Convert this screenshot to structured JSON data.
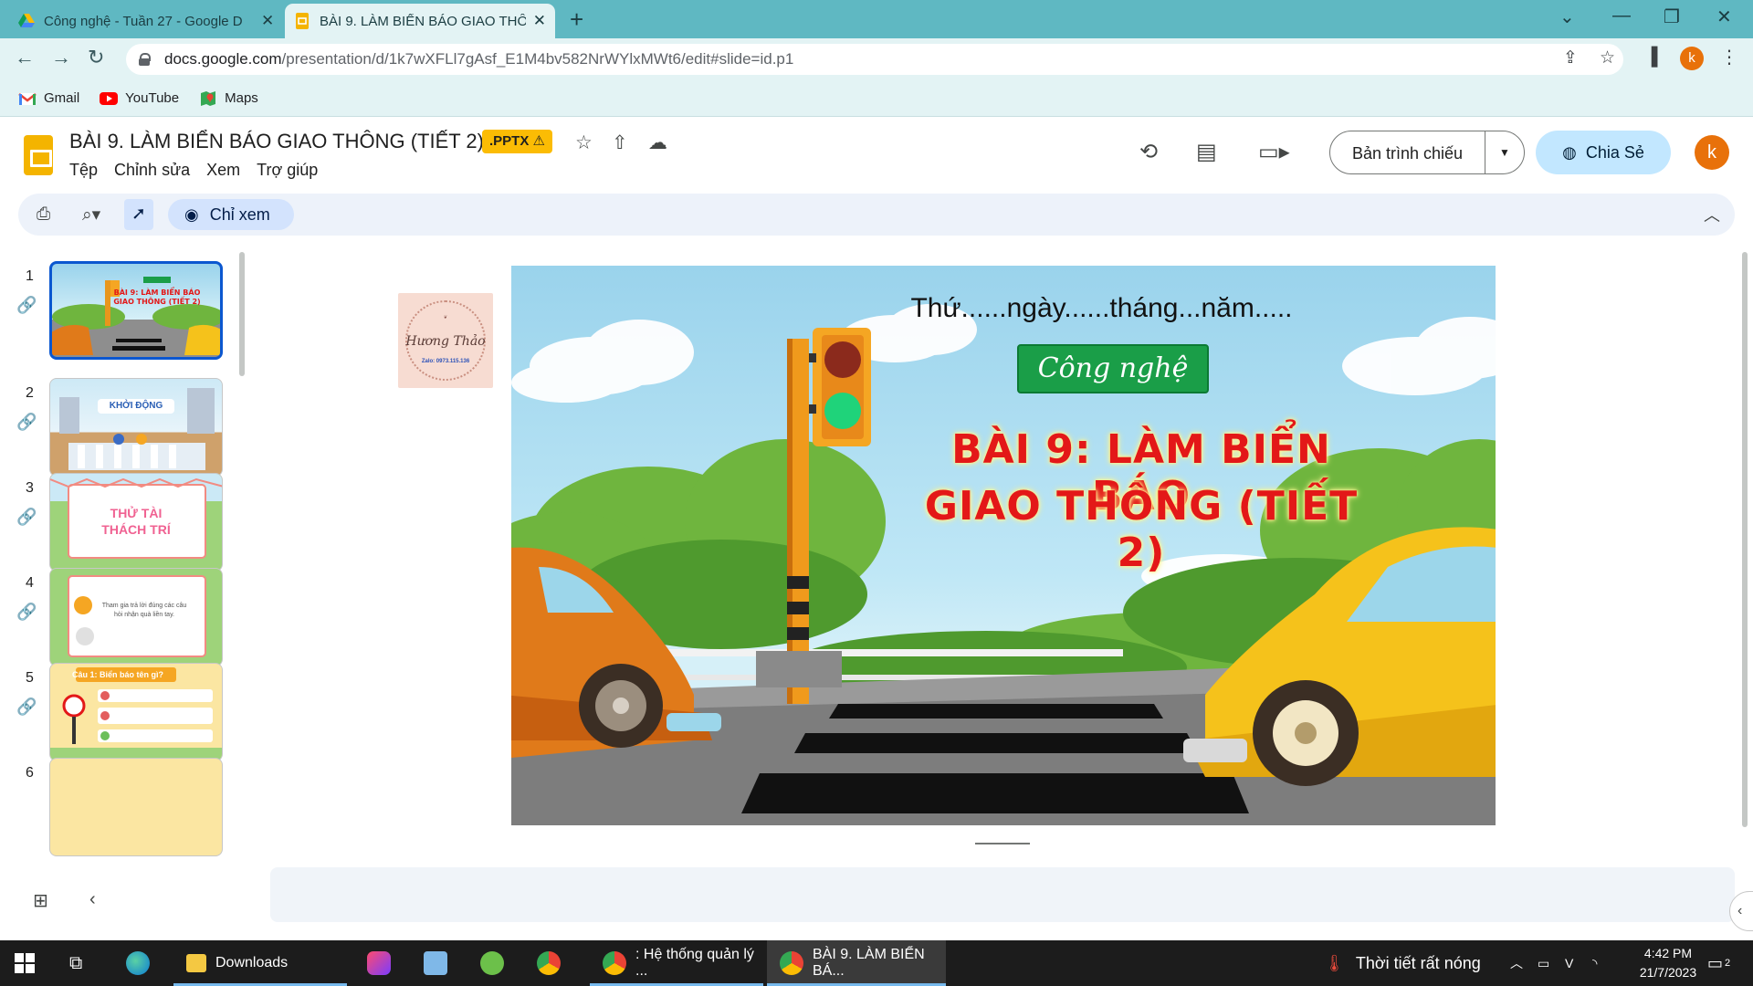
{
  "browser": {
    "tabs": [
      {
        "title": "Công nghệ - Tuần 27 - Google D",
        "active": false
      },
      {
        "title": "BÀI 9. LÀM BIỂN BÁO GIAO THÔ",
        "active": true
      }
    ],
    "url_host": "docs.google.com",
    "url_path": "/presentation/d/1k7wXFLl7gAsf_E1M4bv582NrWYlxMWt6/edit#slide=id.p1",
    "profile_initial": "k",
    "bookmarks": [
      {
        "label": "Gmail",
        "icon": "gmail-icon"
      },
      {
        "label": "YouTube",
        "icon": "youtube-icon"
      },
      {
        "label": "Maps",
        "icon": "maps-icon"
      }
    ]
  },
  "slides_app": {
    "doc_title": "BÀI 9. LÀM BIỂN BÁO GIAO THÔNG (TIẾT 2)",
    "badge": ".PPTX ⚠",
    "menu": [
      "Tệp",
      "Chỉnh sửa",
      "Xem",
      "Trợ giúp"
    ],
    "present_label": "Bản trình chiếu",
    "share_label": "Chia Sẻ",
    "user_initial": "k",
    "view_only_label": "Chỉ xem"
  },
  "filmstrip": {
    "slides": [
      {
        "number": "1",
        "selected": true
      },
      {
        "number": "2",
        "caption": "KHỞI ĐỘNG"
      },
      {
        "number": "3",
        "caption": "THỬ TÀI THÁCH TRÍ"
      },
      {
        "number": "4",
        "caption": "Tham gia trả lời đúng các câu hỏi nhận quà liền tay."
      },
      {
        "number": "5",
        "caption": "Câu 1: Biển báo tên gì?"
      },
      {
        "number": "6"
      }
    ]
  },
  "slide": {
    "date_line": "Thứ......ngày......tháng...năm.....",
    "subject": "Công nghệ",
    "title_line1": "BÀI 9: LÀM BIỂN BÁO",
    "title_line2": "GIAO THÔNG (TIẾT 2)",
    "logo_name": "Hương Thảo",
    "logo_contact": "Zalo: 0973.115.136"
  },
  "taskbar": {
    "apps": [
      {
        "label": "Downloads"
      },
      {
        "label": ": Hệ thống quản lý ..."
      },
      {
        "label": "BÀI 9. LÀM BIỂN BÁ..."
      }
    ],
    "weather": "Thời tiết rất nóng",
    "time": "4:42 PM",
    "date": "21/7/2023",
    "notifications": "2"
  },
  "colors": {
    "chrome_frame": "#5fb8c2",
    "chrome_toolbar": "#e3f3f4",
    "slides_yellow": "#f4b400",
    "share_blue": "#c2e7ff",
    "selected_blue": "#0b57d0",
    "title_red": "#e31818",
    "subject_green": "#1a9e48"
  }
}
